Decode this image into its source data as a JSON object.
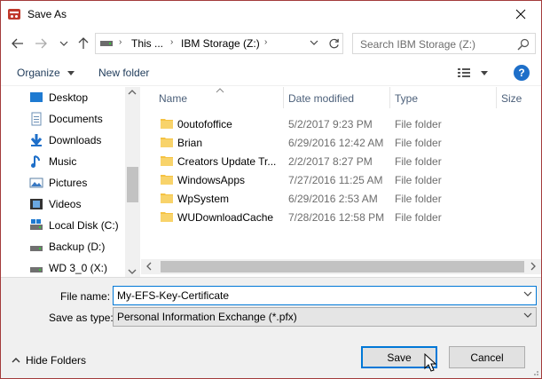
{
  "window": {
    "title": "Save As"
  },
  "address": {
    "crumbs": [
      "This ...",
      "IBM Storage (Z:)"
    ],
    "search_placeholder": "Search IBM Storage (Z:)"
  },
  "toolbar": {
    "organize": "Organize",
    "new_folder": "New folder",
    "help": "?"
  },
  "nav": {
    "items": [
      {
        "label": "Desktop",
        "icon": "desktop-icon"
      },
      {
        "label": "Documents",
        "icon": "documents-icon"
      },
      {
        "label": "Downloads",
        "icon": "downloads-icon"
      },
      {
        "label": "Music",
        "icon": "music-icon"
      },
      {
        "label": "Pictures",
        "icon": "pictures-icon"
      },
      {
        "label": "Videos",
        "icon": "videos-icon"
      },
      {
        "label": "Local Disk (C:)",
        "icon": "drive-icon"
      },
      {
        "label": "Backup (D:)",
        "icon": "drive-icon"
      },
      {
        "label": "WD 3_0 (X:)",
        "icon": "drive-icon"
      }
    ]
  },
  "filelist": {
    "columns": {
      "name": "Name",
      "date": "Date modified",
      "type": "Type",
      "size": "Size"
    },
    "rows": [
      {
        "name": "0outofoffice",
        "date": "5/2/2017 9:23 PM",
        "type": "File folder"
      },
      {
        "name": "Brian",
        "date": "6/29/2016 12:42 AM",
        "type": "File folder"
      },
      {
        "name": "Creators Update Tr...",
        "date": "2/2/2017 8:27 PM",
        "type": "File folder"
      },
      {
        "name": "WindowsApps",
        "date": "7/27/2016 11:25 AM",
        "type": "File folder"
      },
      {
        "name": "WpSystem",
        "date": "6/29/2016 2:53 AM",
        "type": "File folder"
      },
      {
        "name": "WUDownloadCache",
        "date": "7/28/2016 12:58 PM",
        "type": "File folder"
      }
    ]
  },
  "form": {
    "file_name_label": "File name:",
    "file_name_value": "My-EFS-Key-Certificate",
    "save_type_label": "Save as type:",
    "save_type_value": "Personal Information Exchange (*.pfx)"
  },
  "footer": {
    "hide_folders": "Hide Folders",
    "save": "Save",
    "cancel": "Cancel"
  },
  "colors": {
    "accent": "#0078d7",
    "folder": "#f5c242",
    "title_border": "#a33b3b"
  }
}
